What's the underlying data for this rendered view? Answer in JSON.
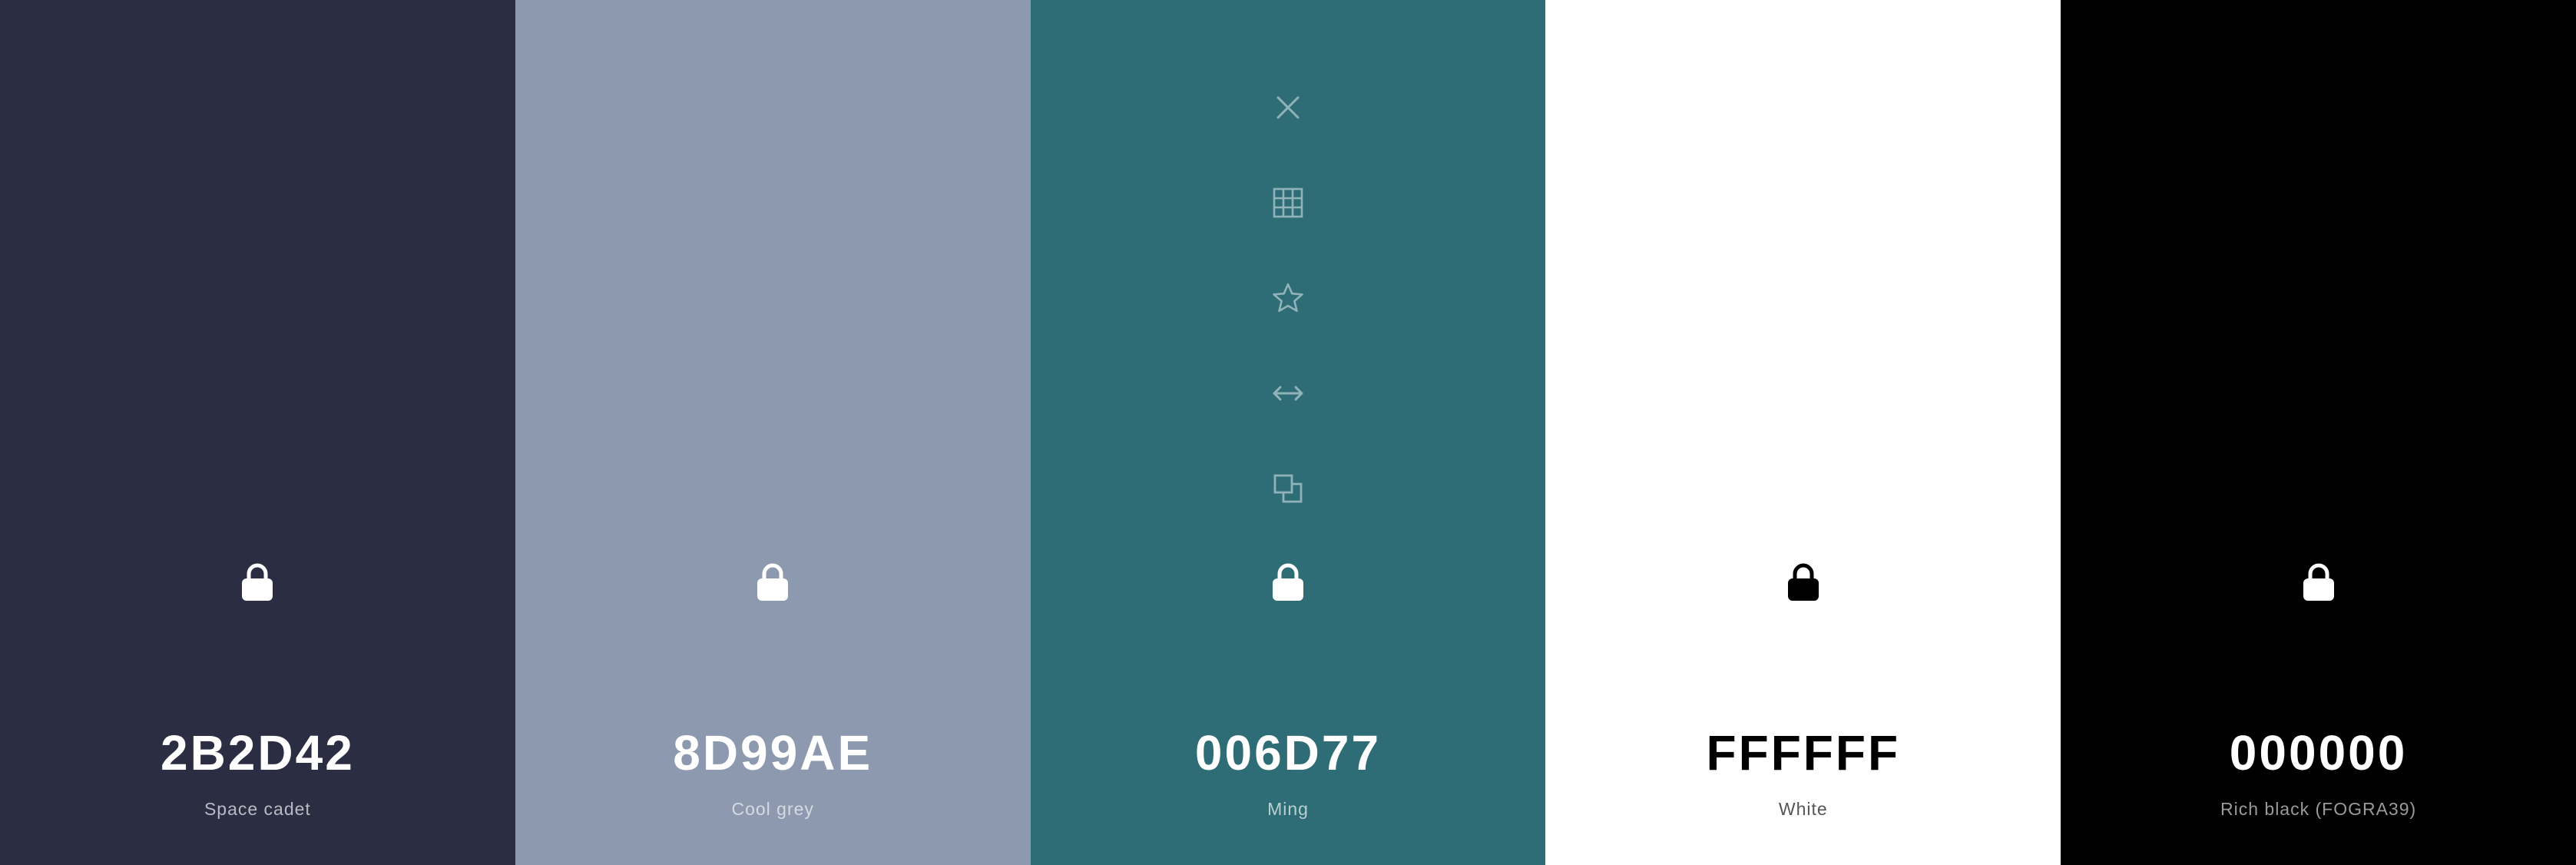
{
  "palette": {
    "swatches": [
      {
        "hex": "2B2D42",
        "name": "Space cadet",
        "color": "#2B2D42",
        "text_color": "#FFFFFF",
        "name_color": "#B9BAC4",
        "lock_color": "#FFFFFF",
        "lock_icon": "lock-icon"
      },
      {
        "hex": "8D99AE",
        "name": "Cool grey",
        "color": "#8D99AE",
        "text_color": "#FFFFFF",
        "name_color": "#D5DAE3",
        "lock_color": "#FFFFFF",
        "lock_icon": "lock-icon"
      },
      {
        "hex": "006D77",
        "name": "Ming",
        "color": "#2E6C76",
        "text_color": "#FFFFFF",
        "name_color": "#B9D0D3",
        "lock_color": "#FFFFFF",
        "lock_icon": "lock-icon"
      },
      {
        "hex": "FFFFFF",
        "name": "White",
        "color": "#FFFFFF",
        "text_color": "#000000",
        "name_color": "#555555",
        "lock_color": "#000000",
        "lock_icon": "lock-icon"
      },
      {
        "hex": "000000",
        "name": "Rich black (FOGRA39)",
        "color": "#000000",
        "text_color": "#FFFFFF",
        "name_color": "#9A9A9A",
        "lock_color": "#FFFFFF",
        "lock_icon": "lock-icon"
      }
    ],
    "hover_tools": {
      "swatch_index": 2,
      "icon_color": "#8FB3B8",
      "icons": [
        "close-icon",
        "grid-icon",
        "star-icon",
        "drag-arrows-icon",
        "copy-icon"
      ]
    }
  }
}
